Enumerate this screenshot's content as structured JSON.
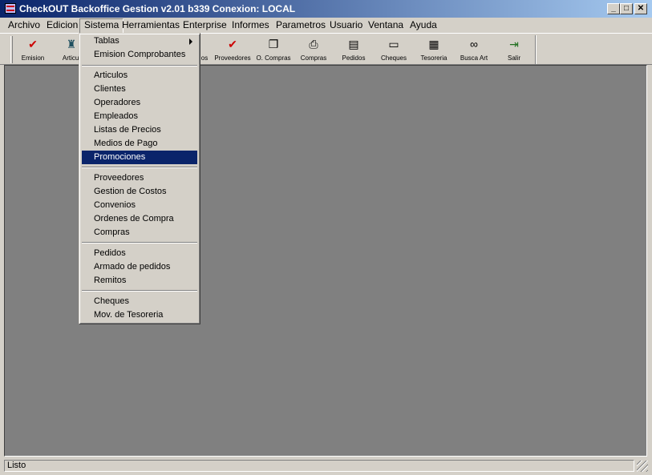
{
  "window": {
    "title": "CheckOUT Backoffice Gestion v2.01 b339 Conexion: LOCAL",
    "controls": {
      "minimize": "_",
      "maximize": "□",
      "close": "✕"
    }
  },
  "menubar": {
    "items": [
      {
        "label": "Archivo"
      },
      {
        "label": "Edicion"
      },
      {
        "label": "Sistema"
      },
      {
        "label": "Herramientas"
      },
      {
        "label": "Enterprise"
      },
      {
        "label": "Informes"
      },
      {
        "label": "Parametros"
      },
      {
        "label": "Usuario"
      },
      {
        "label": "Ventana"
      },
      {
        "label": "Ayuda"
      }
    ]
  },
  "toolbar": {
    "buttons": [
      {
        "label": "Emision",
        "icon": "checkmark-icon",
        "glyph": "✔",
        "color": "#cc0000"
      },
      {
        "label": "Articul",
        "icon": "articles-icon",
        "glyph": "♜",
        "color": "#205060"
      },
      {
        "label": "os",
        "icon": "partial-icon",
        "glyph": "",
        "color": "#000000"
      },
      {
        "label": "Proveedores",
        "icon": "checkmark-icon",
        "glyph": "✔",
        "color": "#cc0000"
      },
      {
        "label": "O. Compras",
        "icon": "document-copy-icon",
        "glyph": "❐",
        "color": "#000000"
      },
      {
        "label": "Compras",
        "icon": "printer-icon",
        "glyph": "⎙",
        "color": "#000000"
      },
      {
        "label": "Pedidos",
        "icon": "window-icon",
        "glyph": "▤",
        "color": "#000000"
      },
      {
        "label": "Cheques",
        "icon": "check-card-icon",
        "glyph": "▭",
        "color": "#000000"
      },
      {
        "label": "Tesoreria",
        "icon": "calculator-icon",
        "glyph": "▦",
        "color": "#000000"
      },
      {
        "label": "Busca Art",
        "icon": "binoculars-icon",
        "glyph": "∞",
        "color": "#000000"
      },
      {
        "label": "Salir",
        "icon": "exit-door-icon",
        "glyph": "⇥",
        "color": "#207020"
      }
    ]
  },
  "sistema_menu": {
    "groups": [
      [
        {
          "label": "Tablas",
          "submenu": true
        },
        {
          "label": "Emision Comprobantes"
        }
      ],
      [
        {
          "label": "Articulos"
        },
        {
          "label": "Clientes"
        },
        {
          "label": "Operadores"
        },
        {
          "label": "Empleados"
        },
        {
          "label": "Listas de Precios"
        },
        {
          "label": "Medios de Pago"
        },
        {
          "label": "Promociones",
          "selected": true
        }
      ],
      [
        {
          "label": "Proveedores"
        },
        {
          "label": "Gestion de Costos"
        },
        {
          "label": "Convenios"
        },
        {
          "label": "Ordenes de Compra"
        },
        {
          "label": "Compras"
        }
      ],
      [
        {
          "label": "Pedidos"
        },
        {
          "label": "Armado de pedidos"
        },
        {
          "label": "Remitos"
        }
      ],
      [
        {
          "label": "Cheques"
        },
        {
          "label": "Mov. de Tesoreria"
        }
      ]
    ]
  },
  "statusbar": {
    "text": "Listo"
  },
  "colors": {
    "title_bar": "#0a246a",
    "workspace": "#808080",
    "selection": "#0a246a",
    "chrome": "#d4d0c8"
  }
}
